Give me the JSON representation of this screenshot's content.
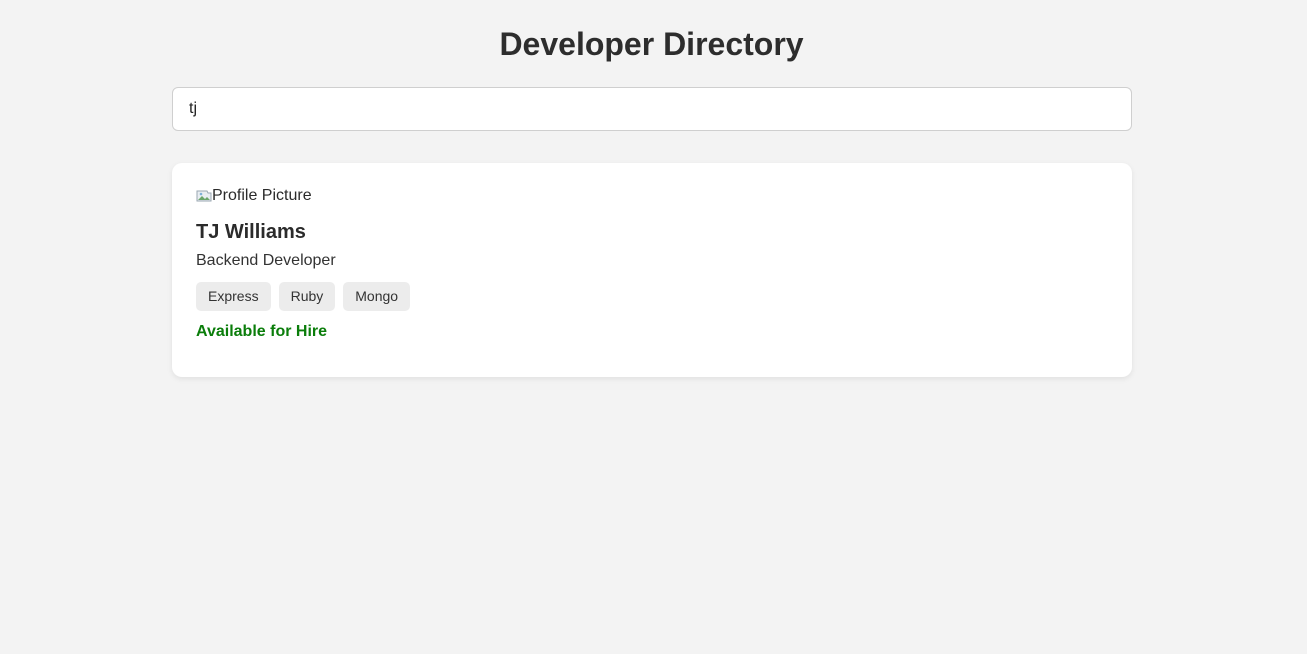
{
  "page": {
    "title": "Developer Directory"
  },
  "search": {
    "value": "tj"
  },
  "results": [
    {
      "avatar_alt": "Profile Picture",
      "name": "TJ Williams",
      "role": "Backend Developer",
      "skills": [
        "Express",
        "Ruby",
        "Mongo"
      ],
      "availability": "Available for Hire",
      "availability_color": "#0a7d0a"
    }
  ],
  "icons": {
    "avatar": "broken-image-icon"
  }
}
